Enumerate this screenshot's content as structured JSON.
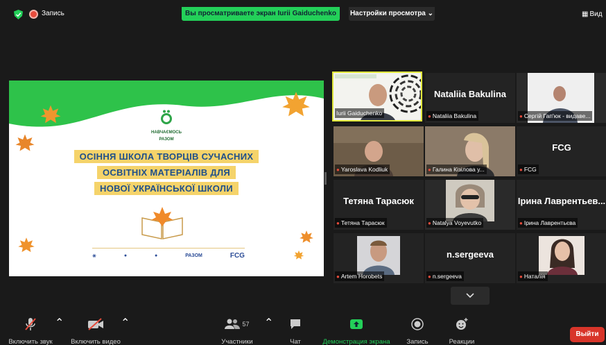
{
  "topbar": {
    "record_label": "Запись",
    "share_banner": "Вы просматриваете экран Iurii Gaiduchenko",
    "view_options": "Настройки просмотра ⌄",
    "view_label": "Вид"
  },
  "slide": {
    "org_line1": "НАВЧАЄМОСЬ",
    "org_line2": "РАЗОМ",
    "title_lines": [
      "ОСІННЯ ШКОЛА ТВОРЦІВ СУЧАСНИХ",
      "ОСВІТНІХ МАТЕРІАЛІВ ДЛЯ",
      "НОВОЇ УКРАЇНСЬКОЇ ШКОЛИ"
    ],
    "footer_logos": [
      "РАЗОМ",
      "FCG"
    ]
  },
  "participants": [
    {
      "name": "Iurii Gaiduchenko",
      "caption": "Iurii Gaiduchenko",
      "muted": false,
      "active": true,
      "video": true
    },
    {
      "name": "Nataliia Bakulina",
      "caption": "Nataliia Bakulina",
      "muted": true,
      "video": false
    },
    {
      "name": "Сергій Гап'юк - видаве...",
      "caption": "Сергій Гап'юк - видаве...",
      "muted": true,
      "video": true
    },
    {
      "name": "Yaroslava Kodliuk",
      "caption": "Yaroslava Kodliuk",
      "muted": true,
      "video": true
    },
    {
      "name": "Галина Кізілова",
      "caption": "Галина Кізілова у...",
      "muted": true,
      "video": true
    },
    {
      "name": "FCG",
      "caption": "FCG",
      "muted": true,
      "video": false
    },
    {
      "name": "Тетяна Тарасюк",
      "caption": "Тетяна Тарасюк",
      "muted": true,
      "video": false
    },
    {
      "name": "Natalya Voyevutko",
      "caption": "Natalya Voyevutko",
      "muted": true,
      "video": true
    },
    {
      "name": "Ірина Лаврентьев...",
      "caption": "Ірина Лаврентьєва",
      "muted": true,
      "video": false
    },
    {
      "name": "Artem Horobets",
      "caption": "Artem Horobets",
      "muted": true,
      "video": true
    },
    {
      "name": "n.sergeeva",
      "caption": "n.sergeeva",
      "muted": true,
      "video": false
    },
    {
      "name": "Наталія",
      "caption": "Наталія",
      "muted": true,
      "video": true
    }
  ],
  "more_button": "⌄",
  "toolbar": {
    "audio_label": "Включить звук",
    "video_label": "Включить видео",
    "participants_label": "Участники",
    "participants_count": "57",
    "chat_label": "Чат",
    "share_label": "Демонстрация экрана",
    "record_label": "Запись",
    "reactions_label": "Реакции",
    "leave_label": "Выйти"
  },
  "colors": {
    "share_green": "#23d059",
    "leave_red": "#d8352a",
    "active_border": "#e1e83a",
    "slide_title_bg": "#f5d36a",
    "slide_title_text": "#1f4f8a"
  }
}
